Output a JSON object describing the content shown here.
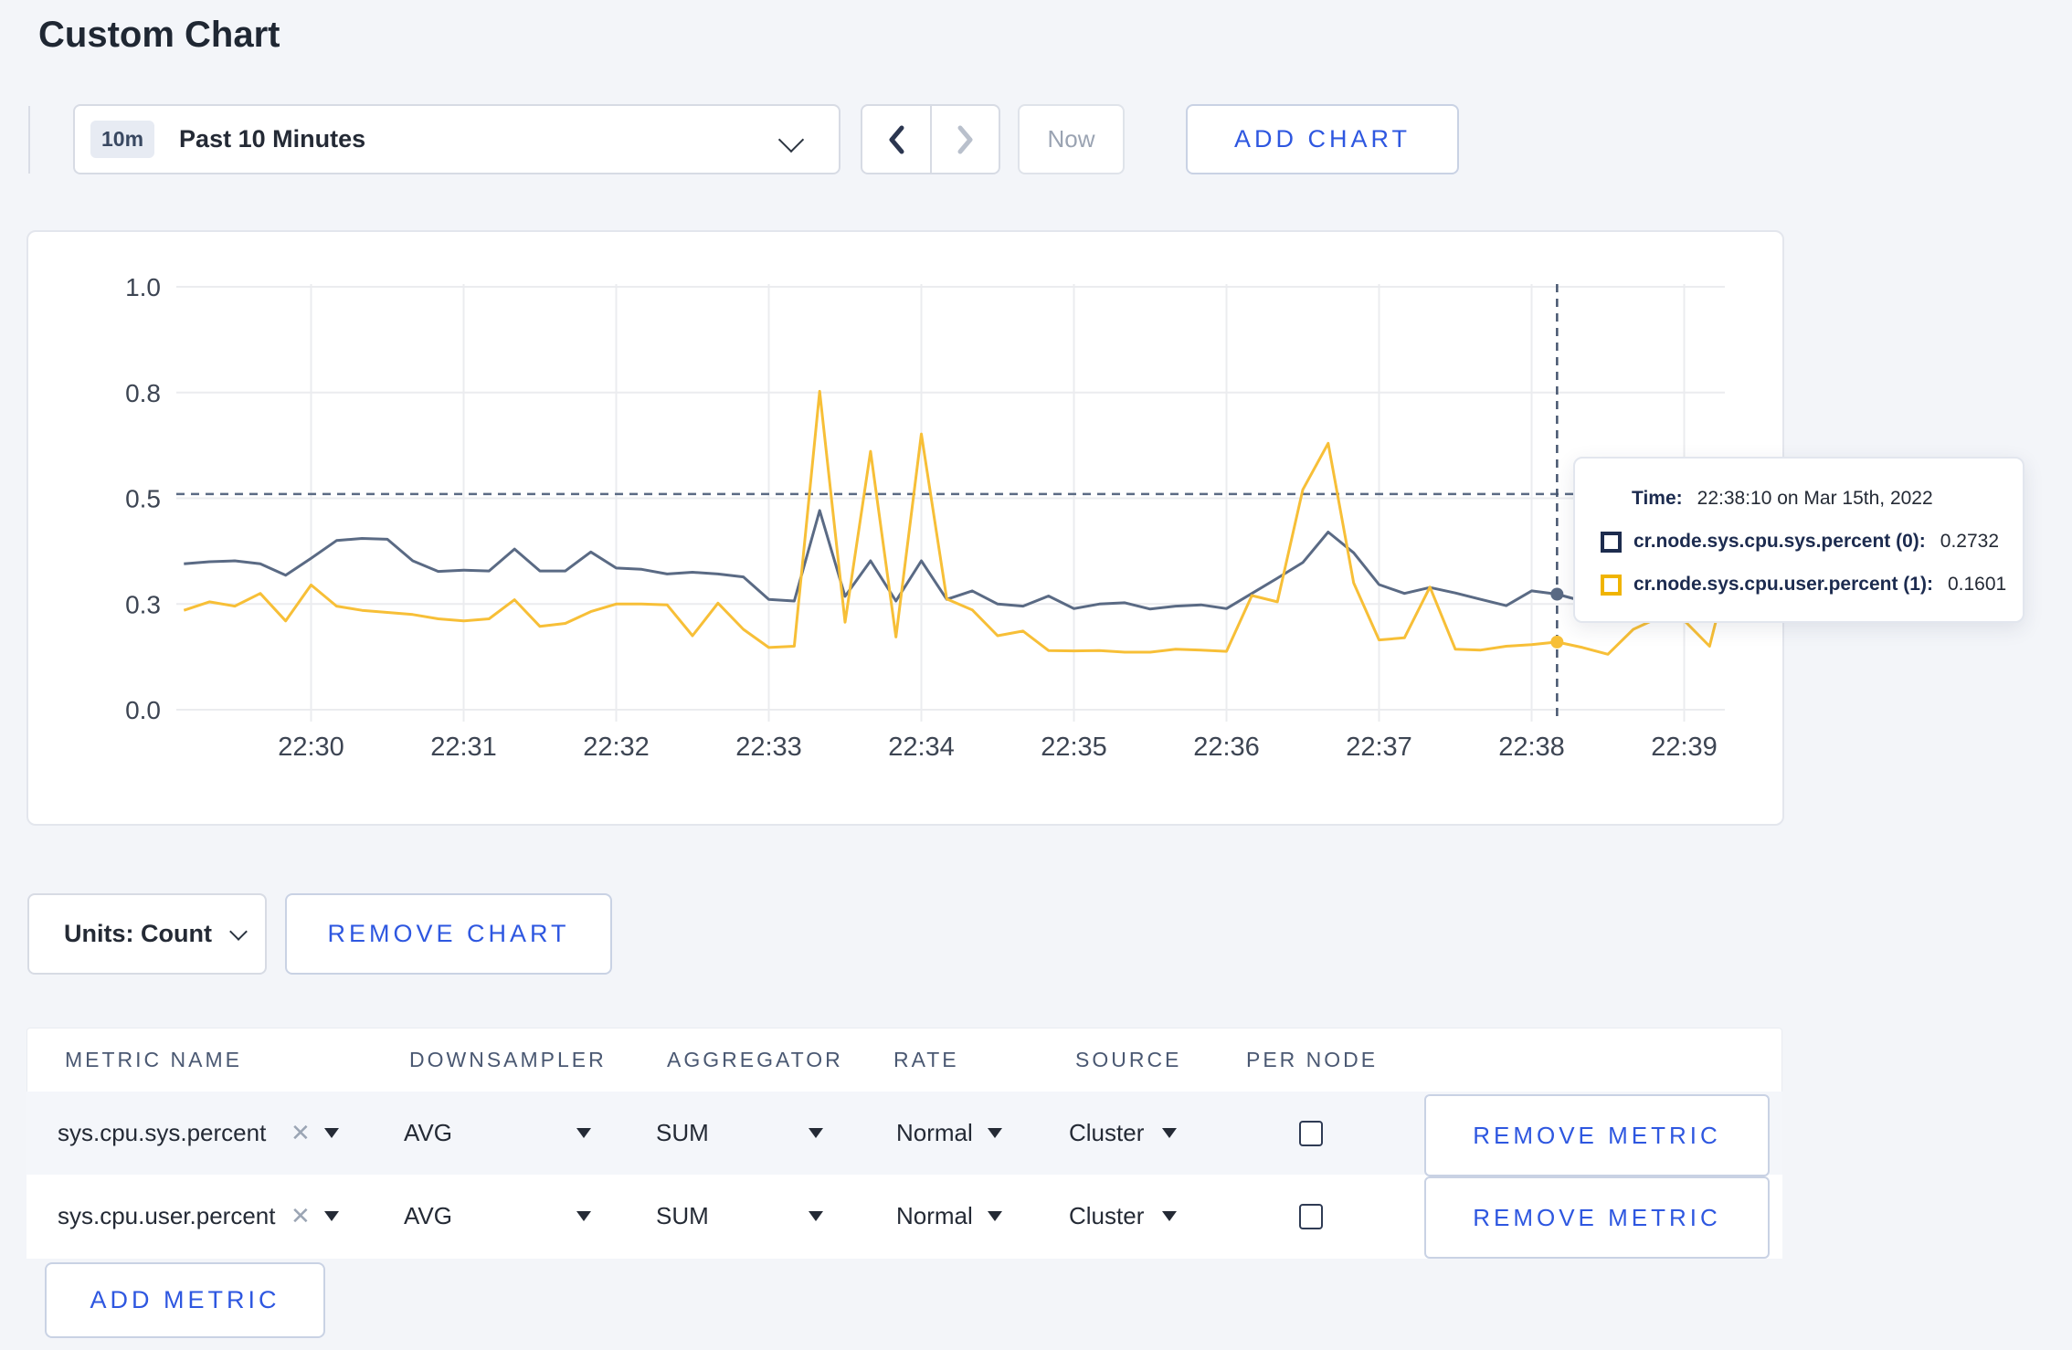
{
  "header": {
    "title": "Custom Chart"
  },
  "toolbar": {
    "time_badge": "10m",
    "time_label": "Past 10 Minutes",
    "now_label": "Now",
    "add_chart_label": "ADD CHART"
  },
  "controls": {
    "units_label": "Units: Count",
    "remove_chart_label": "REMOVE CHART",
    "add_metric_label": "ADD METRIC"
  },
  "tooltip": {
    "time_label": "Time:",
    "time_value": "22:38:10 on Mar 15th, 2022",
    "rows": [
      {
        "label": "cr.node.sys.cpu.sys.percent (0):",
        "value": "0.2732",
        "color": "#1d2c4e"
      },
      {
        "label": "cr.node.sys.cpu.user.percent (1):",
        "value": "0.1601",
        "color": "#f0b400"
      }
    ]
  },
  "table": {
    "headers": [
      "METRIC NAME",
      "DOWNSAMPLER",
      "AGGREGATOR",
      "RATE",
      "SOURCE",
      "PER NODE"
    ],
    "rows": [
      {
        "metric": "sys.cpu.sys.percent",
        "downsampler": "AVG",
        "aggregator": "SUM",
        "rate": "Normal",
        "source": "Cluster",
        "per_node_checked": false,
        "remove_label": "REMOVE METRIC"
      },
      {
        "metric": "sys.cpu.user.percent",
        "downsampler": "AVG",
        "aggregator": "SUM",
        "rate": "Normal",
        "source": "Cluster",
        "per_node_checked": false,
        "remove_label": "REMOVE METRIC"
      }
    ]
  },
  "chart_data": {
    "type": "line",
    "title": "",
    "x_ticks": [
      "22:30",
      "22:31",
      "22:32",
      "22:33",
      "22:34",
      "22:35",
      "22:36",
      "22:37",
      "22:38",
      "22:39"
    ],
    "first_minute_offset_s": 53,
    "y_ticks": {
      "labels": [
        "0.0",
        "0.3",
        "0.5",
        "0.8",
        "1.0"
      ],
      "values": [
        0,
        0.25,
        0.5,
        0.75,
        1
      ]
    },
    "ylim": [
      0,
      1
    ],
    "grid": true,
    "series": [
      {
        "name": "cr.node.sys.cpu.sys.percent",
        "color": "#5a6a84",
        "points": [
          [
            3,
            0.345
          ],
          [
            13,
            0.35
          ],
          [
            23,
            0.352
          ],
          [
            33,
            0.345
          ],
          [
            43,
            0.318
          ],
          [
            53,
            0.358
          ],
          [
            63,
            0.4
          ],
          [
            73,
            0.405
          ],
          [
            83,
            0.403
          ],
          [
            93,
            0.352
          ],
          [
            103,
            0.327
          ],
          [
            113,
            0.33
          ],
          [
            123,
            0.328
          ],
          [
            133,
            0.38
          ],
          [
            143,
            0.328
          ],
          [
            153,
            0.328
          ],
          [
            163,
            0.373
          ],
          [
            173,
            0.335
          ],
          [
            183,
            0.332
          ],
          [
            193,
            0.321
          ],
          [
            203,
            0.325
          ],
          [
            213,
            0.321
          ],
          [
            223,
            0.314
          ],
          [
            233,
            0.261
          ],
          [
            243,
            0.257
          ],
          [
            253,
            0.471
          ],
          [
            263,
            0.268
          ],
          [
            273,
            0.352
          ],
          [
            283,
            0.257
          ],
          [
            293,
            0.352
          ],
          [
            303,
            0.261
          ],
          [
            313,
            0.281
          ],
          [
            323,
            0.25
          ],
          [
            333,
            0.245
          ],
          [
            343,
            0.269
          ],
          [
            353,
            0.239
          ],
          [
            363,
            0.25
          ],
          [
            373,
            0.253
          ],
          [
            383,
            0.238
          ],
          [
            393,
            0.245
          ],
          [
            403,
            0.248
          ],
          [
            413,
            0.239
          ],
          [
            423,
            0.275
          ],
          [
            433,
            0.311
          ],
          [
            443,
            0.348
          ],
          [
            453,
            0.42
          ],
          [
            463,
            0.371
          ],
          [
            473,
            0.296
          ],
          [
            483,
            0.275
          ],
          [
            493,
            0.289
          ],
          [
            503,
            0.276
          ],
          [
            513,
            0.261
          ],
          [
            523,
            0.246
          ],
          [
            533,
            0.281
          ],
          [
            543,
            0.2732
          ],
          [
            553,
            0.257
          ],
          [
            563,
            0.235
          ],
          [
            573,
            0.255
          ],
          [
            583,
            0.272
          ],
          [
            593,
            0.258
          ],
          [
            603,
            0.253
          ],
          [
            608,
            0.263
          ]
        ]
      },
      {
        "name": "cr.node.sys.cpu.user.percent",
        "color": "#f7bf37",
        "points": [
          [
            3,
            0.235
          ],
          [
            13,
            0.255
          ],
          [
            23,
            0.245
          ],
          [
            33,
            0.275
          ],
          [
            43,
            0.21
          ],
          [
            53,
            0.295
          ],
          [
            63,
            0.245
          ],
          [
            73,
            0.235
          ],
          [
            83,
            0.23
          ],
          [
            93,
            0.225
          ],
          [
            103,
            0.215
          ],
          [
            113,
            0.21
          ],
          [
            123,
            0.215
          ],
          [
            133,
            0.26
          ],
          [
            143,
            0.197
          ],
          [
            153,
            0.204
          ],
          [
            163,
            0.232
          ],
          [
            173,
            0.25
          ],
          [
            183,
            0.25
          ],
          [
            193,
            0.248
          ],
          [
            203,
            0.175
          ],
          [
            213,
            0.252
          ],
          [
            223,
            0.19
          ],
          [
            233,
            0.147
          ],
          [
            243,
            0.15
          ],
          [
            253,
            0.753
          ],
          [
            263,
            0.207
          ],
          [
            273,
            0.611
          ],
          [
            283,
            0.172
          ],
          [
            293,
            0.652
          ],
          [
            303,
            0.262
          ],
          [
            313,
            0.236
          ],
          [
            323,
            0.175
          ],
          [
            333,
            0.186
          ],
          [
            343,
            0.14
          ],
          [
            353,
            0.139
          ],
          [
            363,
            0.14
          ],
          [
            373,
            0.136
          ],
          [
            383,
            0.136
          ],
          [
            393,
            0.143
          ],
          [
            403,
            0.141
          ],
          [
            413,
            0.138
          ],
          [
            423,
            0.27
          ],
          [
            433,
            0.255
          ],
          [
            443,
            0.52
          ],
          [
            453,
            0.63
          ],
          [
            463,
            0.3
          ],
          [
            473,
            0.165
          ],
          [
            483,
            0.17
          ],
          [
            493,
            0.29
          ],
          [
            503,
            0.143
          ],
          [
            513,
            0.141
          ],
          [
            523,
            0.15
          ],
          [
            533,
            0.154
          ],
          [
            543,
            0.1601
          ],
          [
            553,
            0.147
          ],
          [
            563,
            0.131
          ],
          [
            573,
            0.19
          ],
          [
            583,
            0.218
          ],
          [
            593,
            0.211
          ],
          [
            603,
            0.15
          ],
          [
            608,
            0.27
          ]
        ]
      }
    ],
    "crosshair": {
      "time_offset_s": 543,
      "hline_value": 0.51,
      "dots": [
        {
          "series": 0,
          "value": 0.2732
        },
        {
          "series": 1,
          "value": 0.1601
        }
      ]
    }
  }
}
